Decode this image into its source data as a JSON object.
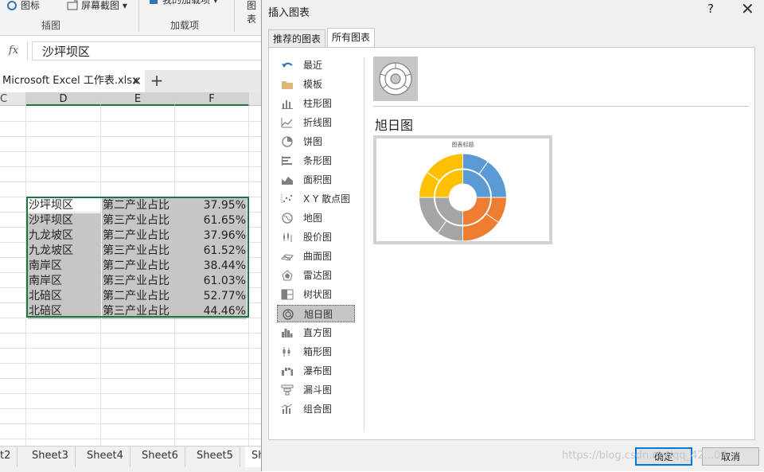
{
  "ribbon": {
    "items": [
      {
        "label": "图标",
        "icon": "icon-icon"
      },
      {
        "label": "屏幕截图 ▾",
        "icon": "screenshot-icon"
      },
      {
        "label": "我的加载项 ▾",
        "icon": "addin-icon"
      },
      {
        "label": "图表"
      }
    ],
    "groups": [
      "插图",
      "加载项"
    ]
  },
  "formula_bar": {
    "fx": "fx",
    "value": "沙坪坝区"
  },
  "file_tab": {
    "name": "Microsoft Excel 工作表.xlsx",
    "close": "✕",
    "new_tab": "+"
  },
  "columns": [
    "C",
    "D",
    "E",
    "F"
  ],
  "table_rows": [
    {
      "district": "沙坪坝区",
      "metric": "第二产业占比",
      "value": "37.95%"
    },
    {
      "district": "沙坪坝区",
      "metric": "第三产业占比",
      "value": "61.65%"
    },
    {
      "district": "九龙坡区",
      "metric": "第二产业占比",
      "value": "37.96%"
    },
    {
      "district": "九龙坡区",
      "metric": "第三产业占比",
      "value": "61.52%"
    },
    {
      "district": "南岸区",
      "metric": "第二产业占比",
      "value": "38.44%"
    },
    {
      "district": "南岸区",
      "metric": "第三产业占比",
      "value": "61.03%"
    },
    {
      "district": "北碚区",
      "metric": "第二产业占比",
      "value": "52.77%"
    },
    {
      "district": "北碚区",
      "metric": "第三产业占比",
      "value": "44.46%"
    }
  ],
  "sheets": [
    "t2",
    "Sheet3",
    "Sheet4",
    "Sheet6",
    "Sheet5",
    "Sh"
  ],
  "dialog": {
    "title": "插入图表",
    "help": "?",
    "close": "✕",
    "tabs": [
      "推荐的图表",
      "所有图表"
    ],
    "active_tab": "所有图表",
    "chart_types": [
      {
        "label": "最近",
        "icon": "undo-icon"
      },
      {
        "label": "模板",
        "icon": "folder-icon"
      },
      {
        "label": "柱形图",
        "icon": "column-chart-icon"
      },
      {
        "label": "折线图",
        "icon": "line-chart-icon"
      },
      {
        "label": "饼图",
        "icon": "pie-chart-icon"
      },
      {
        "label": "条形图",
        "icon": "bar-chart-icon"
      },
      {
        "label": "面积图",
        "icon": "area-chart-icon"
      },
      {
        "label": "X Y 散点图",
        "icon": "scatter-chart-icon"
      },
      {
        "label": "地图",
        "icon": "map-chart-icon"
      },
      {
        "label": "股价图",
        "icon": "stock-chart-icon"
      },
      {
        "label": "曲面图",
        "icon": "surface-chart-icon"
      },
      {
        "label": "雷达图",
        "icon": "radar-chart-icon"
      },
      {
        "label": "树状图",
        "icon": "treemap-chart-icon"
      },
      {
        "label": "旭日图",
        "icon": "sunburst-chart-icon"
      },
      {
        "label": "直方图",
        "icon": "histogram-chart-icon"
      },
      {
        "label": "箱形图",
        "icon": "box-whisker-chart-icon"
      },
      {
        "label": "瀑布图",
        "icon": "waterfall-chart-icon"
      },
      {
        "label": "漏斗图",
        "icon": "funnel-chart-icon"
      },
      {
        "label": "组合图",
        "icon": "combo-chart-icon"
      }
    ],
    "selected_type": "旭日图",
    "preview_heading": "旭日图",
    "preview_chart_title": "图表标题",
    "ok": "确定",
    "cancel": "取消"
  },
  "colors": {
    "excel_green": "#217346",
    "sunburst": [
      "#5b9bd5",
      "#ed7d31",
      "#a5a5a5",
      "#ffc000"
    ]
  },
  "watermark": "https://blog.csdn.net/qq_42...07"
}
